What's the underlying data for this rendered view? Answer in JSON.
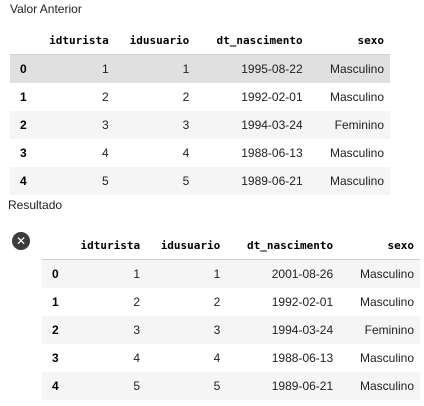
{
  "before": {
    "label": "Valor Anterior",
    "columns": [
      "idturista",
      "idusuario",
      "dt_nascimento",
      "sexo"
    ],
    "rows": [
      {
        "index": "0",
        "idturista": "1",
        "idusuario": "1",
        "dt_nascimento": "1995-08-22",
        "sexo": "Masculino"
      },
      {
        "index": "1",
        "idturista": "2",
        "idusuario": "2",
        "dt_nascimento": "1992-02-01",
        "sexo": "Masculino"
      },
      {
        "index": "2",
        "idturista": "3",
        "idusuario": "3",
        "dt_nascimento": "1994-03-24",
        "sexo": "Feminino"
      },
      {
        "index": "3",
        "idturista": "4",
        "idusuario": "4",
        "dt_nascimento": "1988-06-13",
        "sexo": "Masculino"
      },
      {
        "index": "4",
        "idturista": "5",
        "idusuario": "5",
        "dt_nascimento": "1989-06-21",
        "sexo": "Masculino"
      }
    ]
  },
  "result": {
    "label": "Resultado",
    "status_icon": "error-icon",
    "status_icon_glyph": "✕",
    "columns": [
      "idturista",
      "idusuario",
      "dt_nascimento",
      "sexo"
    ],
    "rows": [
      {
        "index": "0",
        "idturista": "1",
        "idusuario": "1",
        "dt_nascimento": "2001-08-26",
        "sexo": "Masculino"
      },
      {
        "index": "1",
        "idturista": "2",
        "idusuario": "2",
        "dt_nascimento": "1992-02-01",
        "sexo": "Masculino"
      },
      {
        "index": "2",
        "idturista": "3",
        "idusuario": "3",
        "dt_nascimento": "1994-03-24",
        "sexo": "Feminino"
      },
      {
        "index": "3",
        "idturista": "4",
        "idusuario": "4",
        "dt_nascimento": "1988-06-13",
        "sexo": "Masculino"
      },
      {
        "index": "4",
        "idturista": "5",
        "idusuario": "5",
        "dt_nascimento": "1989-06-21",
        "sexo": "Masculino"
      }
    ]
  },
  "colors": {
    "row_stripe": "#f5f5f5",
    "row_highlight": "#e0e0e0",
    "header_border": "#cfcfcf",
    "error_icon_bg": "#3c3c3c"
  }
}
